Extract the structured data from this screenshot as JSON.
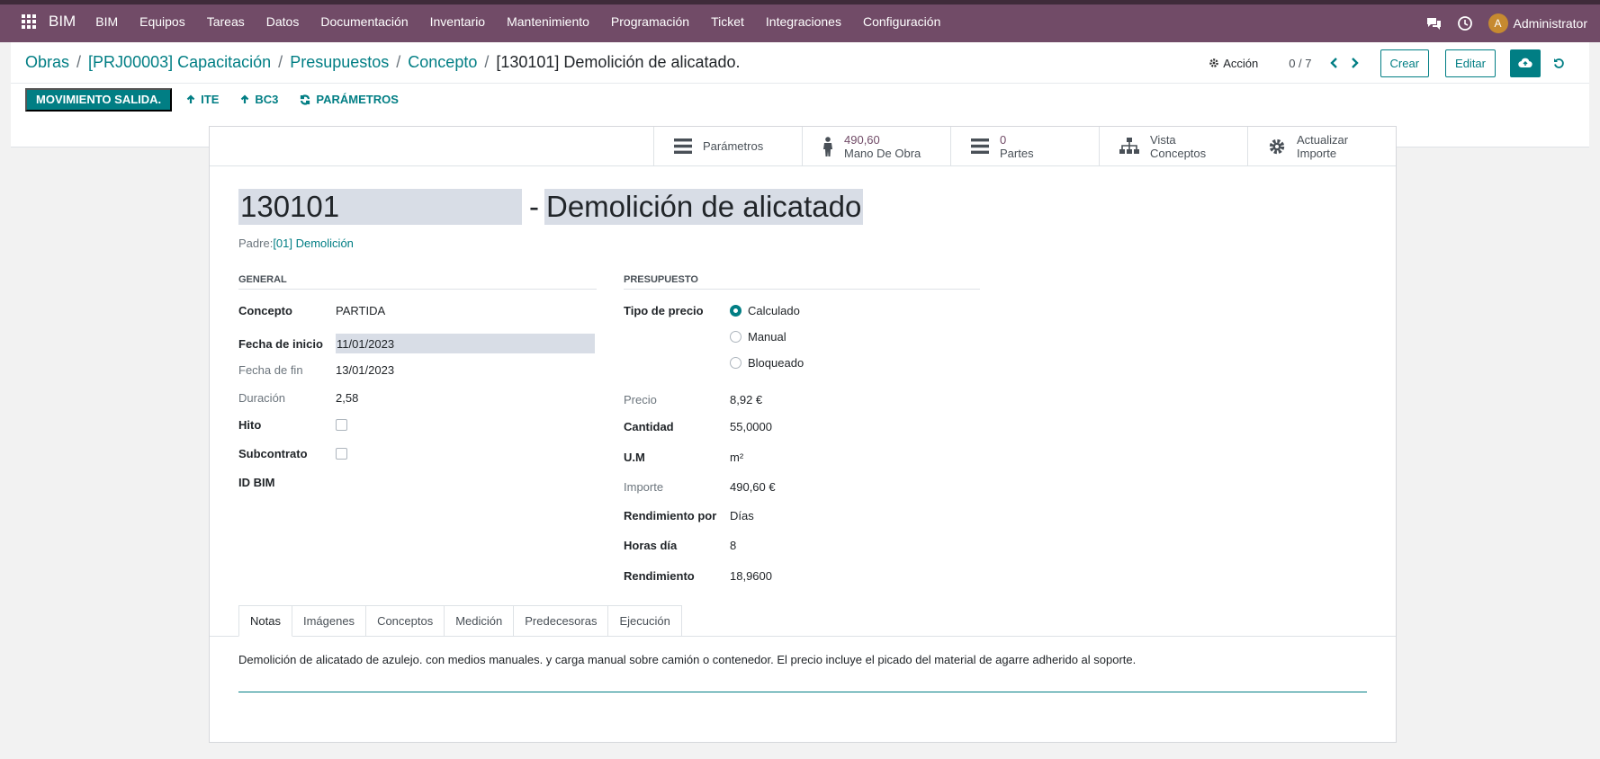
{
  "nav": {
    "brand": "BIM",
    "items": [
      "BIM",
      "Equipos",
      "Tareas",
      "Datos",
      "Documentación",
      "Inventario",
      "Mantenimiento",
      "Programación",
      "Ticket",
      "Integraciones",
      "Configuración"
    ],
    "user": "Administrator",
    "avatar_letter": "A"
  },
  "breadcrumb": {
    "items": [
      "Obras",
      "[PRJ00003] Capacitación",
      "Presupuestos",
      "Concepto"
    ],
    "current": "[130101] Demolición de alicatado."
  },
  "toolbar": {
    "action": "Acción",
    "pager": "0 / 7",
    "create": "Crear",
    "edit": "Editar"
  },
  "status_buttons": {
    "primary": "MOVIMIENTO SALIDA.",
    "ite": "ITE",
    "bc3": "BC3",
    "params": "PARÁMETROS"
  },
  "smart_buttons": {
    "params": "Parámetros",
    "labor_value": "490,60",
    "labor_label": "Mano De Obra",
    "parts_value": "0",
    "parts_label": "Partes",
    "view_line1": "Vista",
    "view_line2": "Conceptos",
    "update_line1": "Actualizar",
    "update_line2": "Importe"
  },
  "record": {
    "code": "130101",
    "separator": "-",
    "name": "Demolición de alicatado",
    "parent_label": "Padre:",
    "parent_value": "[01] Demolición"
  },
  "general": {
    "title": "GENERAL",
    "concept_label": "Concepto",
    "concept_value": "PARTIDA",
    "start_label": "Fecha de inicio",
    "start_value": "11/01/2023",
    "end_label": "Fecha de fin",
    "end_value": "13/01/2023",
    "duration_label": "Duración",
    "duration_value": "2,58",
    "milestone_label": "Hito",
    "subcontract_label": "Subcontrato",
    "bim_label": "ID BIM"
  },
  "budget": {
    "title": "PRESUPUESTO",
    "price_type_label": "Tipo de precio",
    "price_type_options": [
      "Calculado",
      "Manual",
      "Bloqueado"
    ],
    "price_type_selected": "Calculado",
    "price_label": "Precio",
    "price_value": "8,92 €",
    "qty_label": "Cantidad",
    "qty_value": "55,0000",
    "uom_label": "U.M",
    "uom_value": "m²",
    "amount_label": "Importe",
    "amount_value": "490,60 €",
    "perf_by_label": "Rendimiento por",
    "perf_by_value": "Días",
    "hours_label": "Horas día",
    "hours_value": "8",
    "perf_label": "Rendimiento",
    "perf_value": "18,9600"
  },
  "tabs": [
    "Notas",
    "Imágenes",
    "Conceptos",
    "Medición",
    "Predecesoras",
    "Ejecución"
  ],
  "active_tab": "Notas",
  "notes": "Demolición de alicatado de azulejo. con medios manuales. y carga manual sobre camión o contenedor. El precio incluye el picado del material de agarre adherido al soporte.",
  "colors": {
    "navbar": "#714b67",
    "accent": "#017e84",
    "field_bg": "#d8dde6"
  },
  "icons": [
    "apps-grid-icon",
    "chat-icon",
    "clock-icon",
    "gear-icon",
    "chevron-left-icon",
    "chevron-right-icon",
    "cloud-upload-icon",
    "undo-icon",
    "arrow-up-icon",
    "refresh-icon",
    "list-icon",
    "person-icon",
    "sitemap-icon"
  ]
}
